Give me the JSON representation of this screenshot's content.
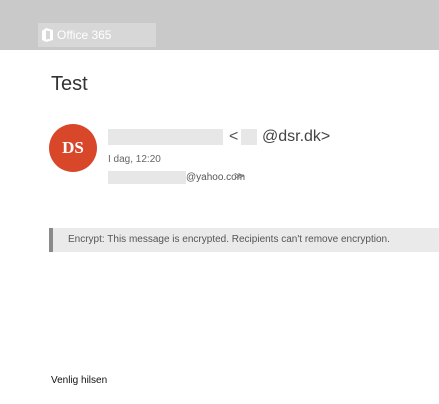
{
  "app": {
    "name": "Office 365",
    "icon": "office-logo-icon"
  },
  "message": {
    "subject": "Test",
    "avatar_initials": "DS",
    "sender_lt": "<",
    "sender_domain": "@dsr.dk>",
    "date": "I dag, 12:20",
    "recipient_domain": "@yahoo.com",
    "expand_glyph": "≫",
    "banner": "Encrypt: This message is encrypted. Recipients can't remove encryption.",
    "signoff": "Venlig hilsen"
  },
  "colors": {
    "avatar": "#d9472b",
    "topbar": "#c9c9c9",
    "banner_bar": "#8a8a8a"
  }
}
